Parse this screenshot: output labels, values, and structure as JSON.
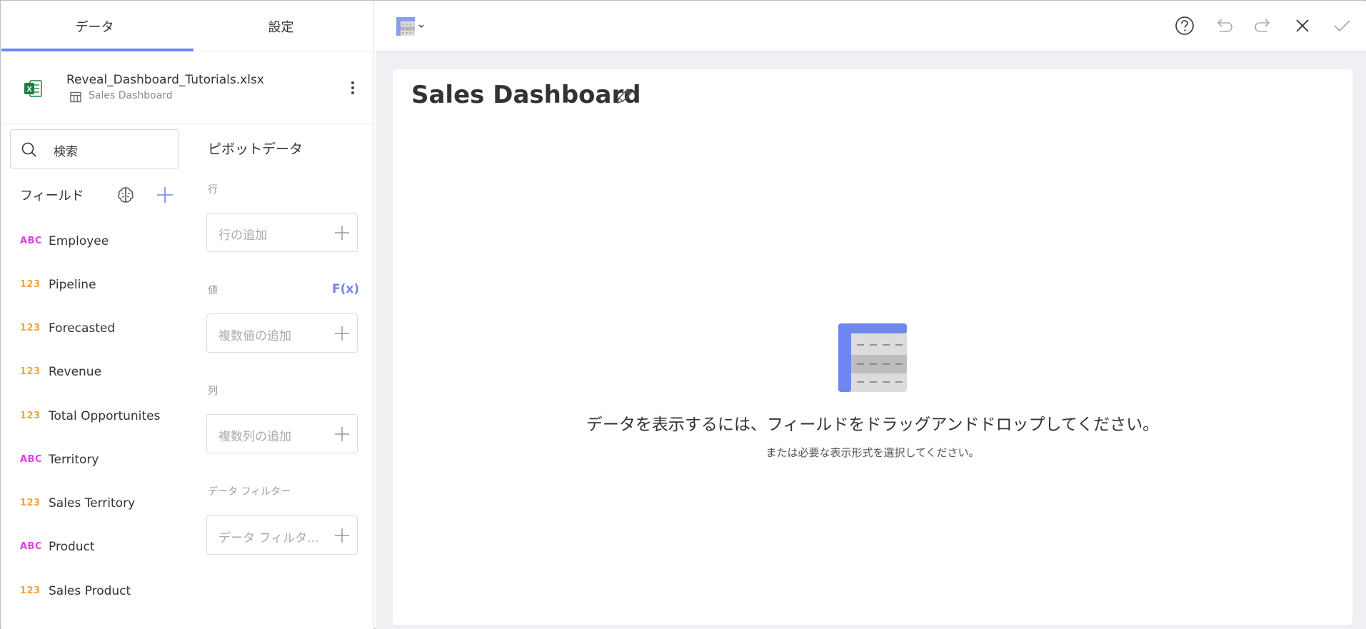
{
  "tabs": {
    "data": "データ",
    "settings": "設定"
  },
  "source": {
    "file_name": "Reveal_Dashboard_Tutorials.xlsx",
    "sheet_name": "Sales Dashboard"
  },
  "search": {
    "text": "検索"
  },
  "fields": {
    "header": "フィールド",
    "items": [
      {
        "type": "ABC",
        "name": "Employee"
      },
      {
        "type": "123",
        "name": "Pipeline"
      },
      {
        "type": "123",
        "name": "Forecasted"
      },
      {
        "type": "123",
        "name": "Revenue"
      },
      {
        "type": "123",
        "name": "Total Opportunites"
      },
      {
        "type": "ABC",
        "name": "Territory"
      },
      {
        "type": "123",
        "name": "Sales Territory"
      },
      {
        "type": "ABC",
        "name": "Product"
      },
      {
        "type": "123",
        "name": "Sales Product"
      }
    ]
  },
  "pivot": {
    "title": "ピボットデータ",
    "rows_label": "行",
    "rows_placeholder": "行の追加",
    "values_label": "値",
    "fx": "F(x)",
    "values_placeholder": "複数値の追加",
    "columns_label": "列",
    "columns_placeholder": "複数列の追加",
    "filters_label": "データ フィルター",
    "filters_placeholder": "データ フィルタ..."
  },
  "card": {
    "title": "Sales Dashboard",
    "empty_message": "データを表示するには、フィールドをドラッグアンドドロップしてください。",
    "empty_sub": "または必要な表示形式を選択してください。"
  },
  "colors": {
    "accent": "#6e86ee",
    "abc_type": "#e040e8",
    "num_type": "#f4a53a",
    "excel_green": "#1e7e45"
  }
}
